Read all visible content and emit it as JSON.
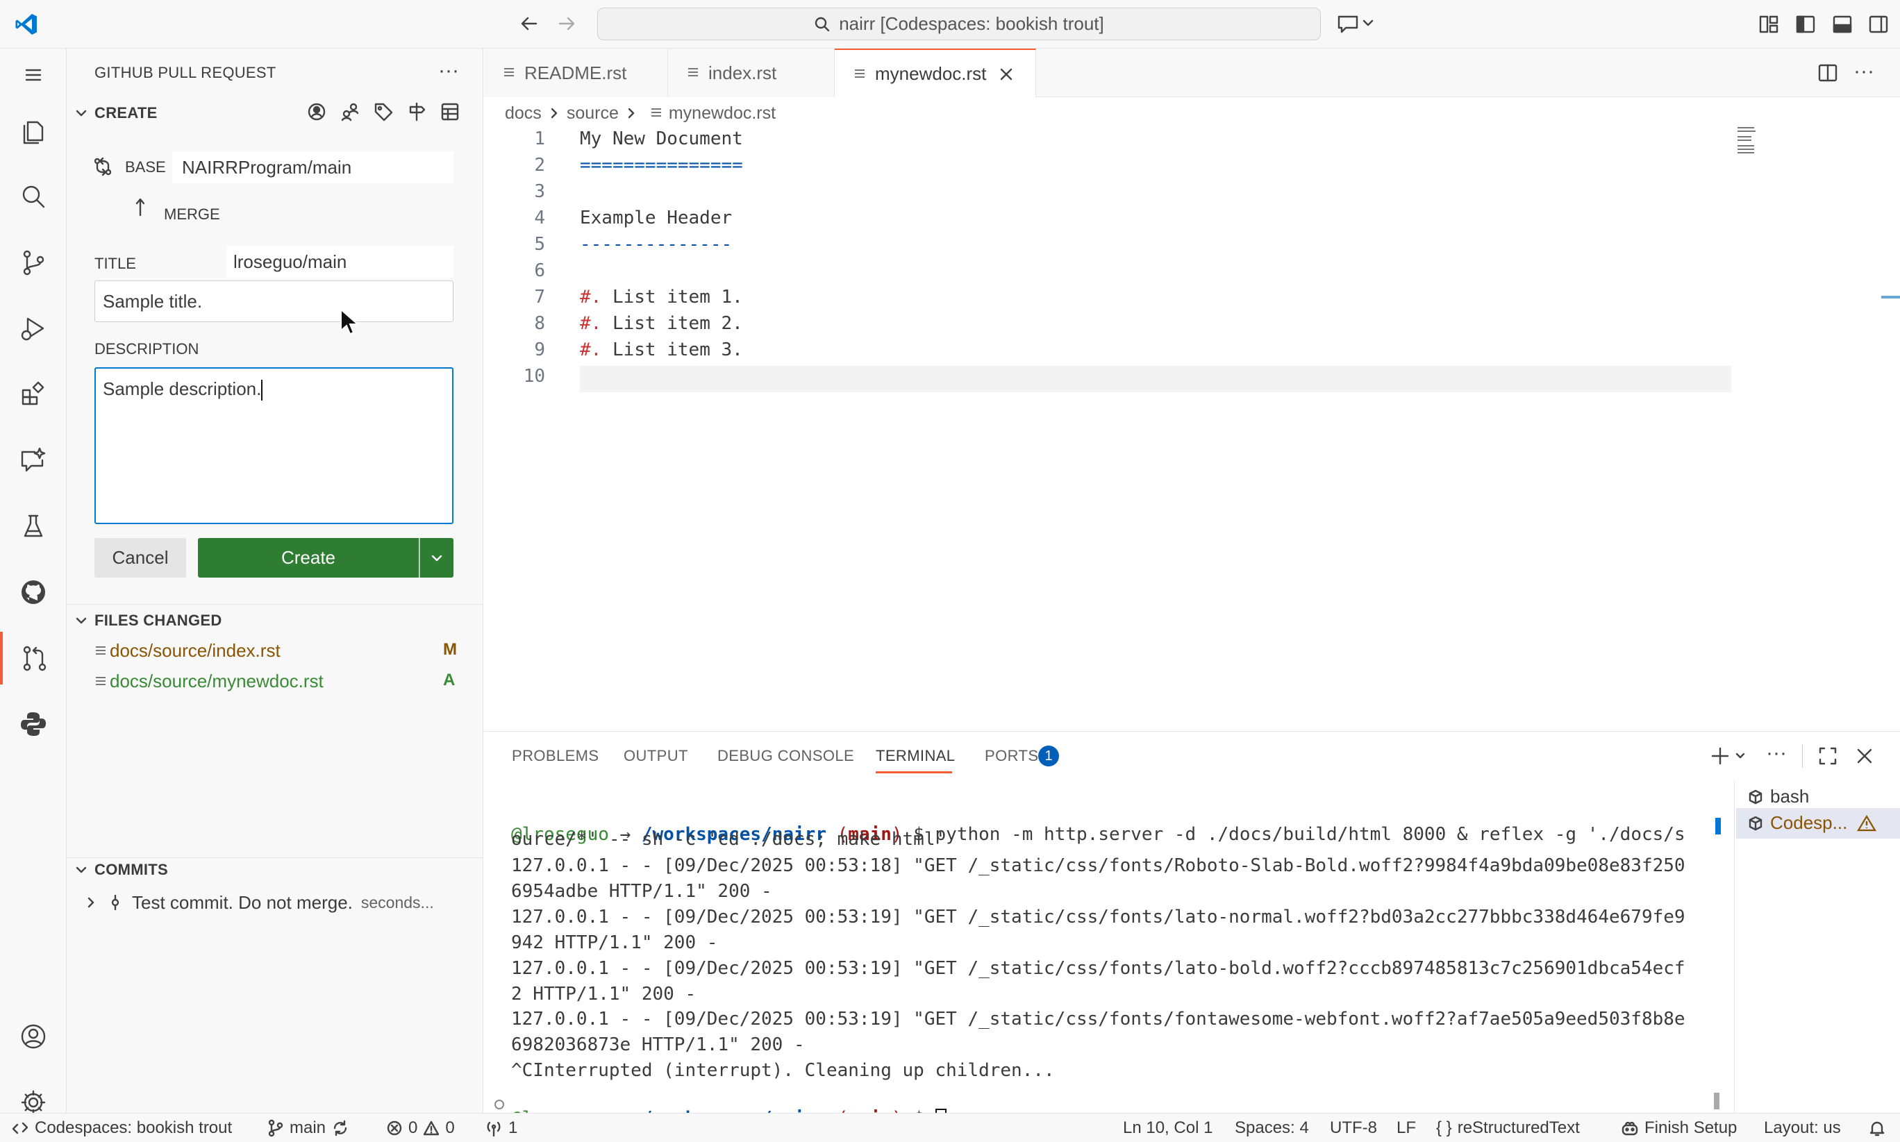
{
  "titlebar": {
    "search_text": "nairr [Codespaces: bookish trout]"
  },
  "sidebar": {
    "header": "GITHUB PULL REQUEST",
    "create_section": "CREATE",
    "base_label": "BASE",
    "base_value": "NAIRRProgram/main",
    "merge_label": "MERGE",
    "merge_value": "lroseguo/main",
    "title_label": "TITLE",
    "title_value": "Sample title.",
    "description_label": "DESCRIPTION",
    "description_value": "Sample description.",
    "cancel_label": "Cancel",
    "create_label": "Create",
    "files_changed_section": "FILES CHANGED",
    "files": [
      {
        "name": "docs/source/index.rst",
        "status": "M",
        "color": "#895503"
      },
      {
        "name": "docs/source/mynewdoc.rst",
        "status": "A",
        "color": "#388a34"
      }
    ],
    "commits_section": "COMMITS",
    "commit": {
      "message": "Test commit. Do not merge.",
      "time": "seconds..."
    }
  },
  "tabs": [
    {
      "label": "README.rst"
    },
    {
      "label": "index.rst"
    },
    {
      "label": "mynewdoc.rst"
    }
  ],
  "breadcrumb": [
    "docs",
    "source",
    "mynewdoc.rst"
  ],
  "editor": {
    "lines": [
      {
        "n": "1",
        "text": "My New Document",
        "color": "#3b3b3b"
      },
      {
        "n": "2",
        "text": "===============",
        "color": "#0451a5"
      },
      {
        "n": "3",
        "text": "",
        "color": "#3b3b3b"
      },
      {
        "n": "4",
        "text": "Example Header",
        "color": "#3b3b3b"
      },
      {
        "n": "5",
        "text": "--------------",
        "color": "#0451a5"
      },
      {
        "n": "6",
        "text": "",
        "color": "#3b3b3b"
      },
      {
        "n": "7",
        "marker": "#.",
        "text": " List item 1.",
        "color": "#3b3b3b"
      },
      {
        "n": "8",
        "marker": "#.",
        "text": " List item 2.",
        "color": "#3b3b3b"
      },
      {
        "n": "9",
        "marker": "#.",
        "text": " List item 3.",
        "color": "#3b3b3b"
      },
      {
        "n": "10",
        "text": "",
        "color": "#3b3b3b"
      }
    ]
  },
  "panel": {
    "tabs": [
      "PROBLEMS",
      "OUTPUT",
      "DEBUG CONSOLE",
      "TERMINAL",
      "PORTS"
    ],
    "ports_badge": "1",
    "prompt_user": "@lroseguo",
    "prompt_arrow": "→",
    "prompt_path": "/workspaces/nairr",
    "prompt_branch_open": "(",
    "prompt_branch": "main",
    "prompt_branch_close": ")",
    "command_line1": " $ python -m http.server -d ./docs/build/html 8000 & reflex -g './docs/s",
    "command_line2": "ource/*' -- sh -c 'cd ./docs; make html'",
    "output": [
      "127.0.0.1 - - [09/Dec/2025 00:53:18] \"GET /_static/css/fonts/Roboto-Slab-Bold.woff2?9984f4a9bda09be08e83f250",
      "6954adbe HTTP/1.1\" 200 -",
      "127.0.0.1 - - [09/Dec/2025 00:53:19] \"GET /_static/css/fonts/lato-normal.woff2?bd03a2cc277bbbc338d464e679fe9",
      "942 HTTP/1.1\" 200 -",
      "127.0.0.1 - - [09/Dec/2025 00:53:19] \"GET /_static/css/fonts/lato-bold.woff2?cccb897485813c7c256901dbca54ecf",
      "2 HTTP/1.1\" 200 -",
      "127.0.0.1 - - [09/Dec/2025 00:53:19] \"GET /_static/css/fonts/fontawesome-webfont.woff2?af7ae505a9eed503f8b8e",
      "6982036873e HTTP/1.1\" 200 -",
      "^CInterrupted (interrupt). Cleaning up children..."
    ],
    "prompt_dollar": " $ ",
    "terminals": [
      {
        "name": "bash"
      },
      {
        "name": "Codesp..."
      }
    ]
  },
  "statusbar": {
    "remote": "Codespaces: bookish trout",
    "branch": "main",
    "errors": "0",
    "warnings": "0",
    "ports": "1",
    "position": "Ln 10, Col 1",
    "spaces": "Spaces: 4",
    "encoding": "UTF-8",
    "eol": "LF",
    "language": "reStructuredText",
    "finish_setup": "Finish Setup",
    "layout": "Layout: us"
  },
  "colors": {
    "accent": "#f25e36",
    "create_button": "#2e7d32",
    "prompt_user": "#388a34",
    "prompt_path": "#0451a5",
    "prompt_branch": "#a31515",
    "list_marker": "#cd3131"
  }
}
